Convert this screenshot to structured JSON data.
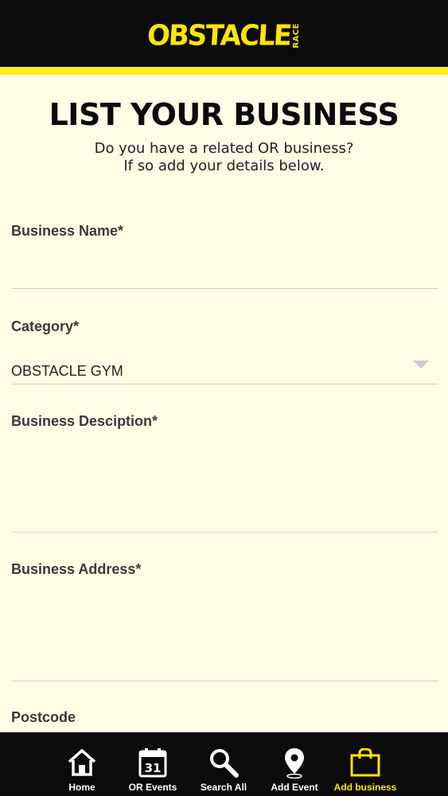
{
  "header": {
    "logo_main": "OBSTACLE",
    "logo_side": "RACE"
  },
  "page": {
    "title": "LIST YOUR BUSINESS",
    "intro_line1": "Do you have a related OR business?",
    "intro_line2": "If so add your details below."
  },
  "form": {
    "business_name": {
      "label": "Business Name*",
      "value": ""
    },
    "category": {
      "label": "Category*",
      "value": "OBSTACLE GYM"
    },
    "description": {
      "label": "Business Desciption*",
      "value": ""
    },
    "address": {
      "label": "Business Address*",
      "value": ""
    },
    "postcode": {
      "label": "Postcode",
      "value": ""
    }
  },
  "nav": {
    "items": [
      {
        "label": "Home",
        "icon": "home-icon",
        "active": false
      },
      {
        "label": "OR Events",
        "icon": "calendar-icon",
        "calendar_day": "31",
        "active": false
      },
      {
        "label": "Search All",
        "icon": "search-icon",
        "active": false
      },
      {
        "label": "Add Event",
        "icon": "map-pin-icon",
        "active": false
      },
      {
        "label": "Add business",
        "icon": "shopping-bag-icon",
        "active": true
      }
    ]
  },
  "colors": {
    "brand_yellow": "#ffe500",
    "header_black": "#0b0b0b",
    "page_bg": "#fffde6",
    "field_line": "#cfd0d8"
  }
}
